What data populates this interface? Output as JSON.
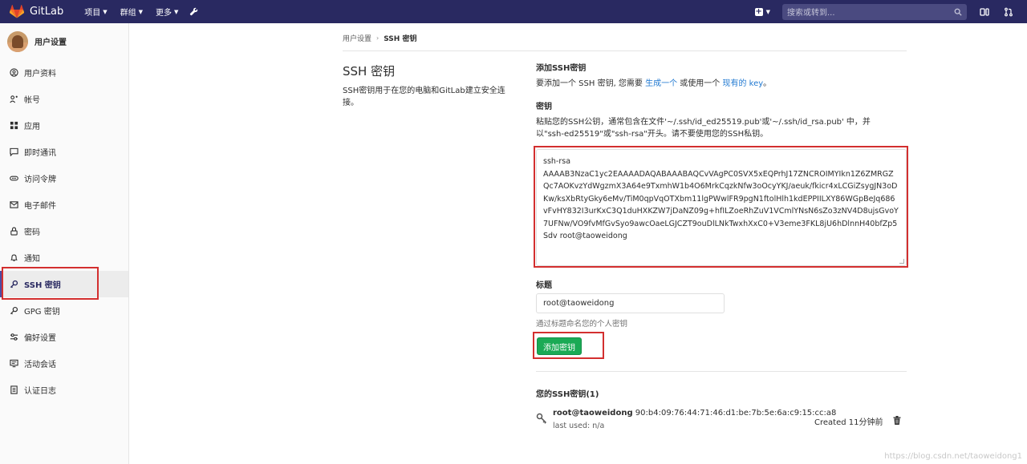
{
  "navbar": {
    "brand": "GitLab",
    "menu": [
      "项目",
      "群组",
      "更多"
    ],
    "search_placeholder": "搜索或转到..."
  },
  "sidebar": {
    "title": "用户设置",
    "items": [
      {
        "label": "用户资料",
        "icon": "user-icon"
      },
      {
        "label": "帐号",
        "icon": "account-icon"
      },
      {
        "label": "应用",
        "icon": "apps-icon"
      },
      {
        "label": "即时通讯",
        "icon": "chat-icon"
      },
      {
        "label": "访问令牌",
        "icon": "token-icon"
      },
      {
        "label": "电子邮件",
        "icon": "mail-icon"
      },
      {
        "label": "密码",
        "icon": "lock-icon"
      },
      {
        "label": "通知",
        "icon": "bell-icon"
      },
      {
        "label": "SSH 密钥",
        "icon": "key-icon",
        "active": true
      },
      {
        "label": "GPG 密钥",
        "icon": "key-icon"
      },
      {
        "label": "偏好设置",
        "icon": "preferences-icon"
      },
      {
        "label": "活动会话",
        "icon": "monitor-icon"
      },
      {
        "label": "认证日志",
        "icon": "list-icon"
      }
    ]
  },
  "breadcrumb": {
    "parent": "用户设置",
    "current": "SSH 密钥"
  },
  "intro": {
    "title": "SSH 密钥",
    "description": "SSH密钥用于在您的电脑和GitLab建立安全连接。"
  },
  "add_section": {
    "heading": "添加SSH密钥",
    "desc_prefix": "要添加一个 SSH 密钥, 您需要 ",
    "link_generate": "生成一个",
    "desc_middle": " 或使用一个 ",
    "link_existing": "现有的 key",
    "desc_suffix": "。"
  },
  "key_field": {
    "label": "密钥",
    "help": "粘贴您的SSH公钥，通常包含在文件'~/.ssh/id_ed25519.pub'或'~/.ssh/id_rsa.pub' 中，并以\"ssh-ed25519\"或\"ssh-rsa\"开头。请不要使用您的SSH私钥。",
    "value": "ssh-rsa\nAAAAB3NzaC1yc2EAAAADAQABAAABAQCvVAgPC0SVX5xEQPrhJ17ZNCROIMYIkn1Z6ZMRGZQc7AOKvzYdWgzmX3A64e9TxmhW1b4O6MrkCqzkNfw3oOcyYKJ/aeuk/fkicr4xLCGiZsygJN3oDKw/ksXbRtyGky6eMv/TiM0qpVqOTXbm11lgPWwlFR9pgN1ftolHlh1kdEPPIILXY86WGpBeJq686vFvHY832I3urKxC3Q1duHXKZW7jDaNZ09g+hfILZoeRhZuV1VCmlYNsN6sZo3zNV4D8ujsGvoY7UFNw/VO9fvMfGvSyo9awcOaeLGJCZT9ouDlLNkTwxhXxC0+V3eme3FKL8jU6hDlnnH40bfZp5Sdv root@taoweidong"
  },
  "title_field": {
    "label": "标题",
    "value": "root@taoweidong",
    "hint": "通过标题命名您的个人密钥"
  },
  "add_button": "添加密钥",
  "keys_list": {
    "heading": "您的SSH密钥(1)",
    "items": [
      {
        "title": "root@taoweidong",
        "fingerprint": "90:b4:09:76:44:71:46:d1:be:7b:5e:6a:c9:15:cc:a8",
        "last_used": "last used: n/a",
        "created": "Created 11分钟前"
      }
    ]
  },
  "watermark": "https://blog.csdn.net/taoweidong1",
  "colors": {
    "navbar": "#292961",
    "accent": "#1f78d1",
    "success": "#1aaa55",
    "highlight": "#d32f2f"
  }
}
